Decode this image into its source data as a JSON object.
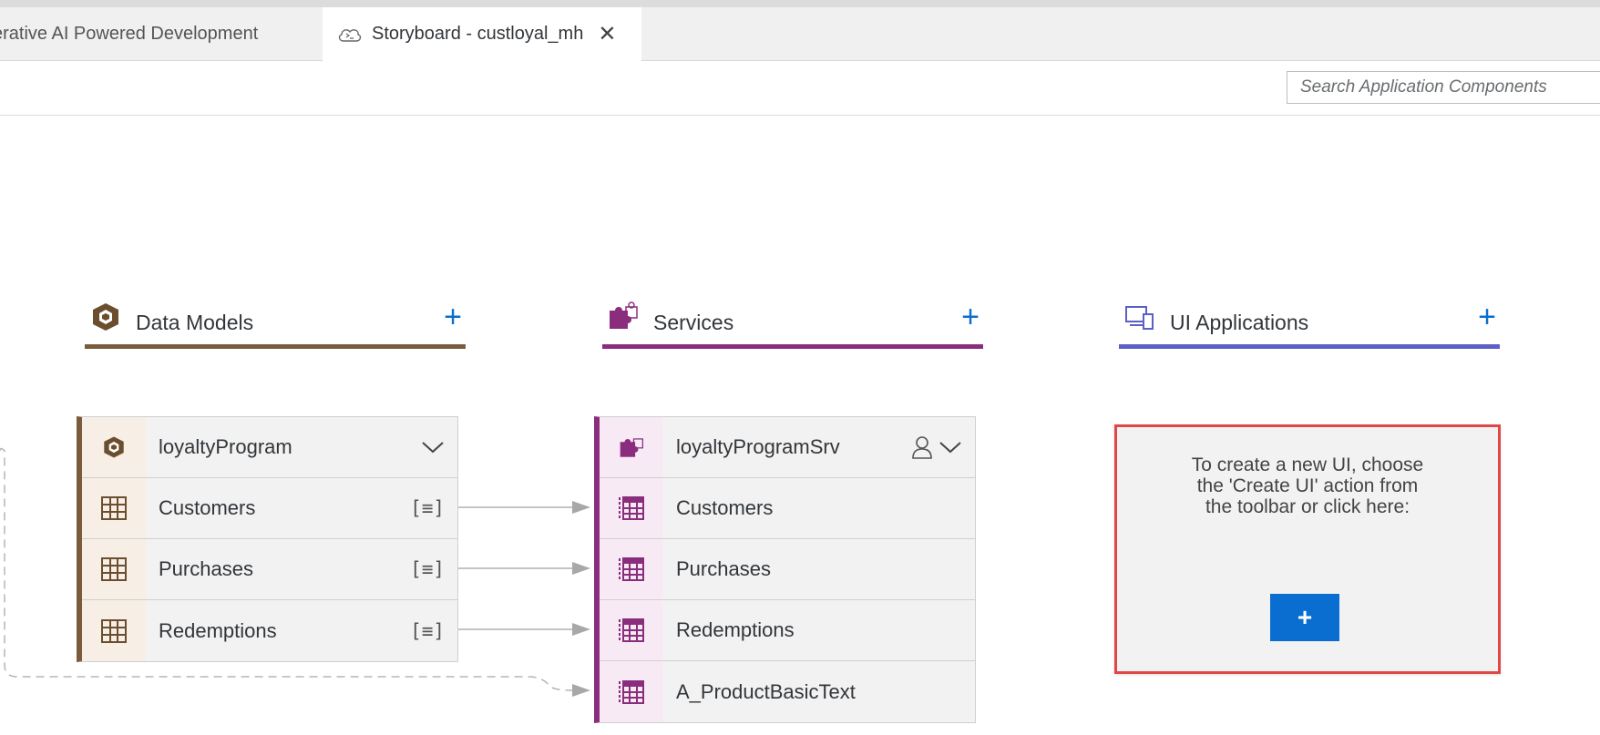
{
  "tabs": [
    {
      "label": "erative AI Powered Development"
    },
    {
      "label": "Storyboard - custloyal_mh"
    }
  ],
  "toolbar": {
    "search_placeholder": "Search Application Components"
  },
  "columns": {
    "data_models": {
      "title": "Data Models",
      "add": "+"
    },
    "services": {
      "title": "Services",
      "add": "+"
    },
    "ui_applications": {
      "title": "UI Applications",
      "add": "+"
    }
  },
  "data_model_box": {
    "title": "loyaltyProgram",
    "entities": [
      {
        "label": "Customers",
        "badge": "[≡]"
      },
      {
        "label": "Purchases",
        "badge": "[≡]"
      },
      {
        "label": "Redemptions",
        "badge": "[≡]"
      }
    ]
  },
  "service_box": {
    "title": "loyaltyProgramSrv",
    "entities": [
      {
        "label": "Customers"
      },
      {
        "label": "Purchases"
      },
      {
        "label": "Redemptions"
      },
      {
        "label": "A_ProductBasicText"
      }
    ]
  },
  "ui_box": {
    "text_lines": [
      "To create a new UI, choose",
      "the 'Create UI' action from",
      "the toolbar or click here:"
    ],
    "button": "+"
  },
  "colors": {
    "data_models_accent": "#7a5c3c",
    "services_accent": "#8b2d7d",
    "ui_accent": "#5b5fc7",
    "primary_button": "#0a6ed1",
    "highlight_border": "#e04848"
  }
}
